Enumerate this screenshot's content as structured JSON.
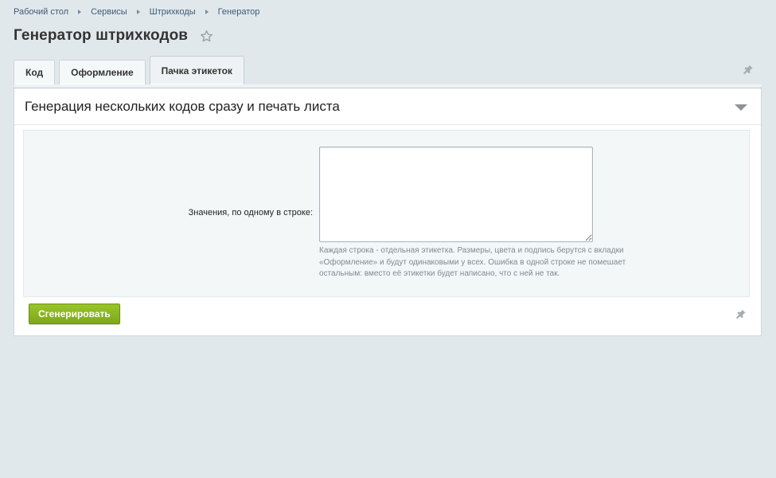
{
  "breadcrumb": {
    "items": [
      "Рабочий стол",
      "Сервисы",
      "Штрихкоды",
      "Генератор"
    ]
  },
  "page": {
    "title": "Генератор штрихкодов"
  },
  "tabs": [
    {
      "label": "Код",
      "active": false
    },
    {
      "label": "Оформление",
      "active": false
    },
    {
      "label": "Пачка этикеток",
      "active": true
    }
  ],
  "section": {
    "title": "Генерация нескольких кодов сразу и печать листа"
  },
  "form": {
    "values_label": "Значения, по одному в строке:",
    "values_value": "",
    "hint": "Каждая строка - отдельная этикетка. Размеры, цвета и подпись берутся с вкладки «Оформление» и будут одинаковыми у всех. Ошибка в одной строке не помешает остальным: вместо её этикетки будет написано, что с ней не так."
  },
  "actions": {
    "generate_label": "Сгенерировать"
  },
  "icons": {
    "favorite": "star-outline-icon",
    "pin": "pin-icon",
    "collapse": "triangle-down-icon"
  },
  "colors": {
    "background": "#e1e8eb",
    "link": "#3d5a7a",
    "button": "#8ab520",
    "hint_text": "#7f8b92"
  }
}
